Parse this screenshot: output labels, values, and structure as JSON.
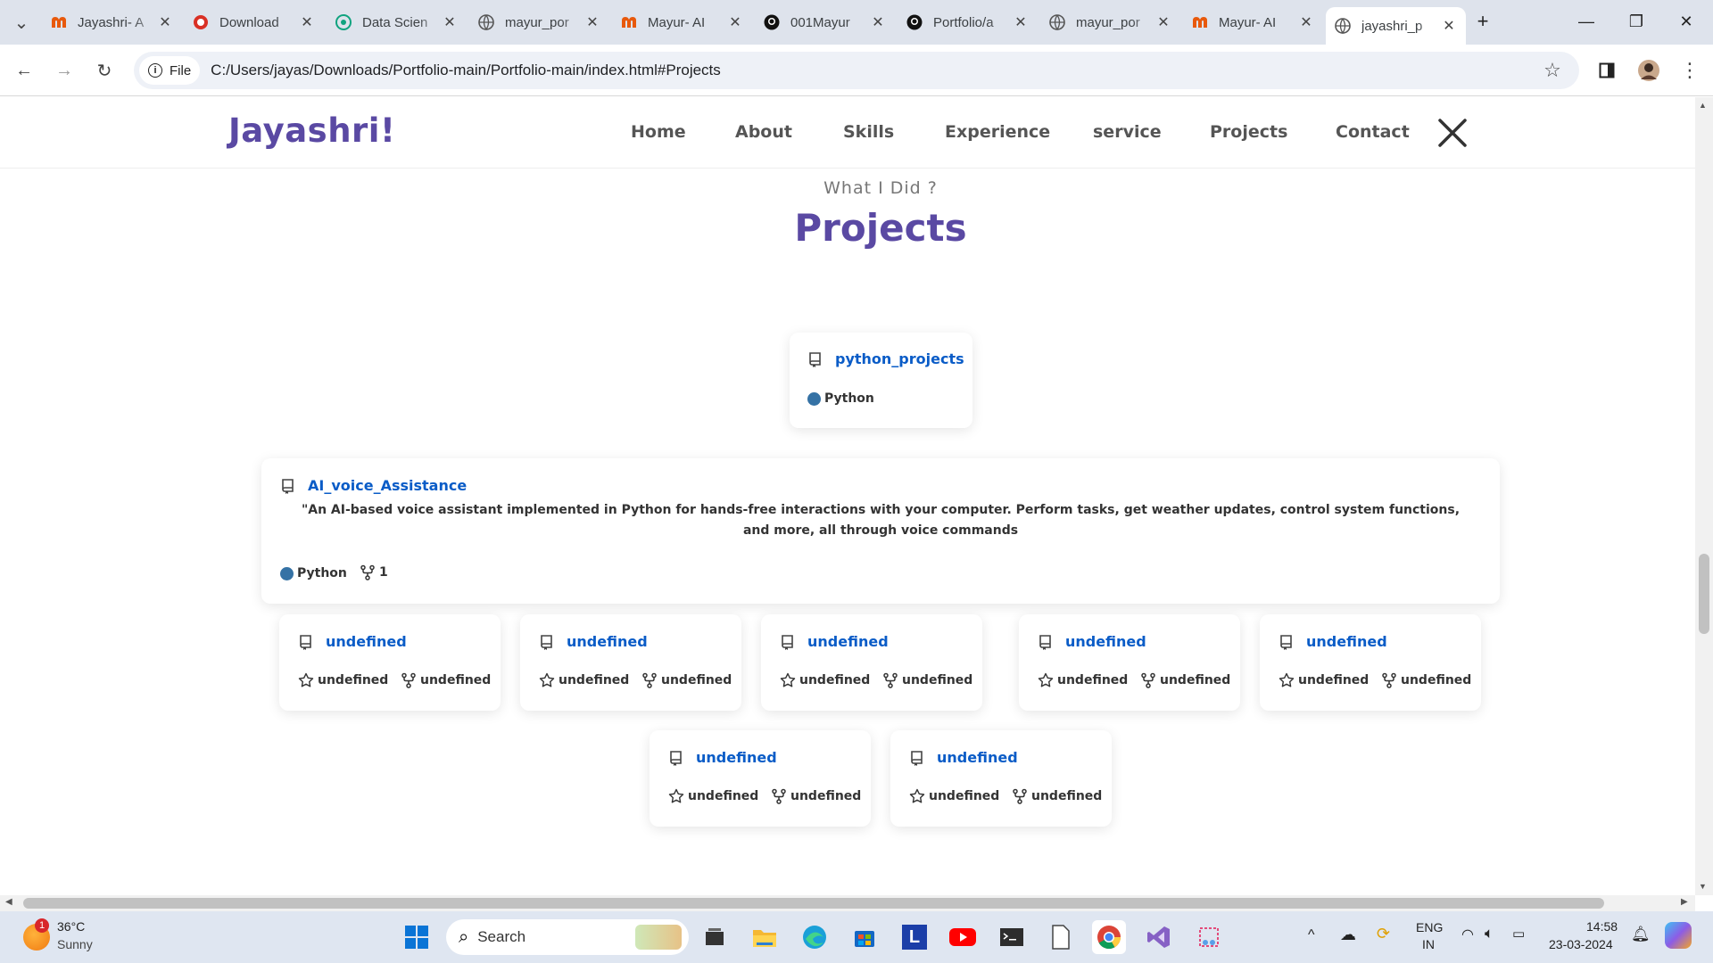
{
  "browser": {
    "tabs": [
      {
        "title": "Jayashri- A",
        "favicon": "m-icon",
        "color": "#e8590c"
      },
      {
        "title": "Download",
        "favicon": "download-red-icon",
        "color": "#d93025"
      },
      {
        "title": "Data Scien",
        "favicon": "chatgpt-icon",
        "color": "#10a37f"
      },
      {
        "title": "mayur_por",
        "favicon": "globe-icon",
        "color": "#5f6368"
      },
      {
        "title": "Mayur- AI",
        "favicon": "m-icon",
        "color": "#e8590c"
      },
      {
        "title": "001Mayur",
        "favicon": "github-icon",
        "color": "#111"
      },
      {
        "title": "Portfolio/a",
        "favicon": "github-icon",
        "color": "#111"
      },
      {
        "title": "mayur_por",
        "favicon": "globe-icon",
        "color": "#5f6368"
      },
      {
        "title": "Mayur- AI",
        "favicon": "m-icon",
        "color": "#e8590c"
      },
      {
        "title": "jayashri_p",
        "favicon": "globe-icon",
        "color": "#5f6368",
        "active": true
      }
    ],
    "chip_label": "File",
    "url": "C:/Users/jayas/Downloads/Portfolio-main/Portfolio-main/index.html#Projects"
  },
  "site": {
    "logo": "Jayashri!",
    "nav": [
      "Home",
      "About",
      "Skills",
      "Experience",
      "service",
      "Projects",
      "Contact"
    ],
    "section_subtitle": "What I Did ?",
    "section_title": "Projects"
  },
  "projects": {
    "featured": {
      "name": "python_projects",
      "language": "Python"
    },
    "voice": {
      "name": "AI_voice_Assistance",
      "description": "\"An AI-based voice assistant implemented in Python for hands-free interactions with your computer. Perform tasks, get weather updates, control system functions, and more, all through voice commands",
      "language": "Python",
      "forks": "1"
    },
    "undefined_cards": [
      {
        "name": "undefined",
        "stars": "undefined",
        "forks": "undefined"
      },
      {
        "name": "undefined",
        "stars": "undefined",
        "forks": "undefined"
      },
      {
        "name": "undefined",
        "stars": "undefined",
        "forks": "undefined"
      },
      {
        "name": "undefined",
        "stars": "undefined",
        "forks": "undefined"
      },
      {
        "name": "undefined",
        "stars": "undefined",
        "forks": "undefined"
      },
      {
        "name": "undefined",
        "stars": "undefined",
        "forks": "undefined"
      },
      {
        "name": "undefined",
        "stars": "undefined",
        "forks": "undefined"
      }
    ]
  },
  "taskbar": {
    "weather_temp": "36°C",
    "weather_desc": "Sunny",
    "weather_badge": "1",
    "search_placeholder": "Search",
    "lang_line1": "ENG",
    "lang_line2": "IN",
    "time": "14:58",
    "date": "23-03-2024"
  }
}
